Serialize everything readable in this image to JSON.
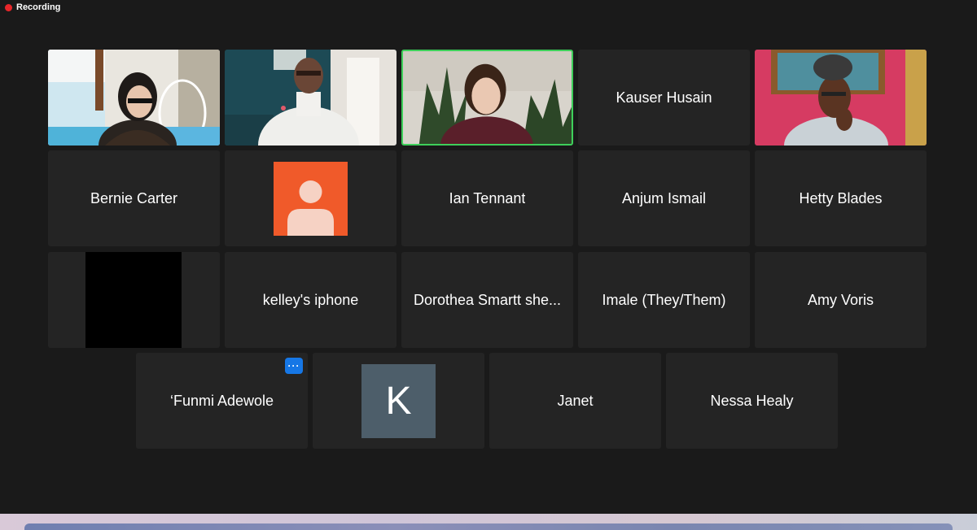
{
  "recording": {
    "label": "Recording"
  },
  "participants": [
    {
      "name": "",
      "kind": "video",
      "scene": "woman-glasses"
    },
    {
      "name": "",
      "kind": "video",
      "scene": "man-white-top"
    },
    {
      "name": "",
      "kind": "video",
      "scene": "woman-plants",
      "active": true
    },
    {
      "name": "Kauser Husain",
      "kind": "name"
    },
    {
      "name": "",
      "kind": "video",
      "scene": "woman-headwrap"
    },
    {
      "name": "Bernie Carter",
      "kind": "name"
    },
    {
      "name": "",
      "kind": "avatar-default"
    },
    {
      "name": "Ian Tennant",
      "kind": "name"
    },
    {
      "name": "Anjum Ismail",
      "kind": "name"
    },
    {
      "name": "Hetty Blades",
      "kind": "name"
    },
    {
      "name": "",
      "kind": "black"
    },
    {
      "name": "kelley's iphone",
      "kind": "name"
    },
    {
      "name": "Dorothea Smartt she...",
      "kind": "name"
    },
    {
      "name": "Imale (They/Them)",
      "kind": "name"
    },
    {
      "name": "Amy Voris",
      "kind": "name"
    },
    {
      "name": "‘Funmi Adewole",
      "kind": "name",
      "menu": true
    },
    {
      "name": "",
      "kind": "avatar-initial",
      "initial": "K"
    },
    {
      "name": "Janet",
      "kind": "name"
    },
    {
      "name": "Nessa Healy",
      "kind": "name"
    }
  ],
  "colors": {
    "active_speaker_border": "#3ecf5a",
    "recording_dot": "#e8262a",
    "menu_button": "#1677e6",
    "default_avatar": "#f05a2a",
    "initial_avatar": "#4d5e6a"
  },
  "more_button": {
    "icon": "ellipsis-icon",
    "label": "···"
  }
}
